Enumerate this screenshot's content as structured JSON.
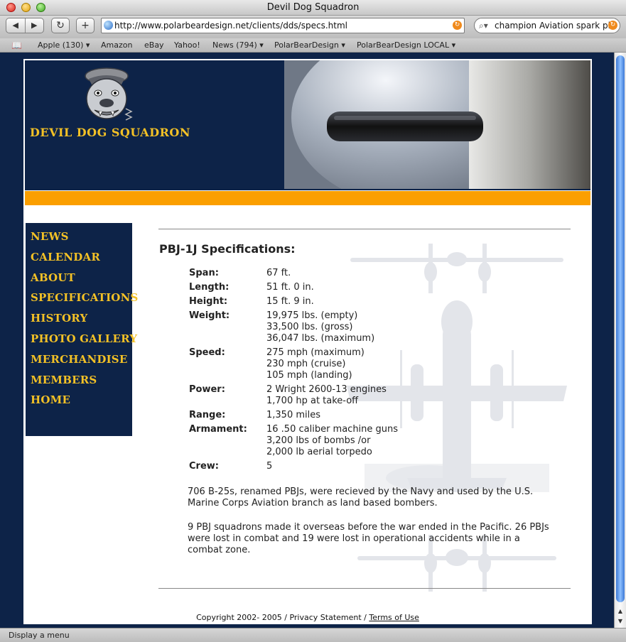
{
  "window": {
    "title": "Devil Dog Squadron"
  },
  "toolbar": {
    "back_icon": "back-arrow-icon",
    "forward_icon": "forward-arrow-icon",
    "reload_glyph": "↻",
    "add_glyph": "+",
    "url": "http://www.polarbeardesign.net/clients/dds/specs.html",
    "search_value": "champion Aviation spark pl"
  },
  "bookmarks": [
    {
      "label": "Apple (130) ▾"
    },
    {
      "label": "Amazon"
    },
    {
      "label": "eBay"
    },
    {
      "label": "Yahoo!"
    },
    {
      "label": "News (794) ▾"
    },
    {
      "label": "PolarBearDesign ▾"
    },
    {
      "label": "PolarBearDesign LOCAL ▾"
    }
  ],
  "site": {
    "title": "DEVIL DOG SQUADRON"
  },
  "nav": [
    "NEWS",
    "CALENDAR",
    "ABOUT",
    "SPECIFICATIONS",
    "HISTORY",
    "PHOTO GALLERY",
    "MERCHANDISE",
    "MEMBERS",
    "HOME"
  ],
  "content": {
    "title": "PBJ-1J Specifications:",
    "specs": [
      {
        "label": "Span:",
        "values": [
          "67 ft."
        ]
      },
      {
        "label": "Length:",
        "values": [
          "51 ft. 0 in."
        ]
      },
      {
        "label": "Height:",
        "values": [
          "15 ft. 9 in."
        ]
      },
      {
        "label": "Weight:",
        "values": [
          "19,975 lbs. (empty)",
          "33,500 lbs. (gross)",
          "36,047 lbs. (maximum)"
        ]
      },
      {
        "label": "Speed:",
        "values": [
          "275 mph (maximum)",
          "230 mph (cruise)",
          "105 mph (landing)"
        ]
      },
      {
        "label": "Power:",
        "values": [
          "2 Wright 2600-13 engines",
          "1,700 hp at take-off"
        ]
      },
      {
        "label": "Range:",
        "values": [
          "1,350 miles"
        ]
      },
      {
        "label": "Armament:",
        "values": [
          "16 .50 caliber machine guns",
          "3,200 lbs of bombs /or",
          "2,000 lb aerial torpedo"
        ]
      },
      {
        "label": "Crew:",
        "values": [
          "5"
        ]
      }
    ],
    "para1": "706 B-25s, renamed PBJs, were recieved by the Navy and used by the U.S. Marine Corps Aviation branch as land based bombers.",
    "para2": "9 PBJ squadrons made it overseas before the war ended in the Pacific. 26 PBJs were lost in combat and 19 were lost in operational accidents while in a combat zone."
  },
  "footer": {
    "copyright": "Copyright 2002- 2005 / Privacy Statement / ",
    "terms": "Terms of Use"
  },
  "statusbar": {
    "text": "Display a menu"
  },
  "colors": {
    "navy": "#0d2348",
    "gold": "#f3c126",
    "orange": "#fb9f00"
  }
}
